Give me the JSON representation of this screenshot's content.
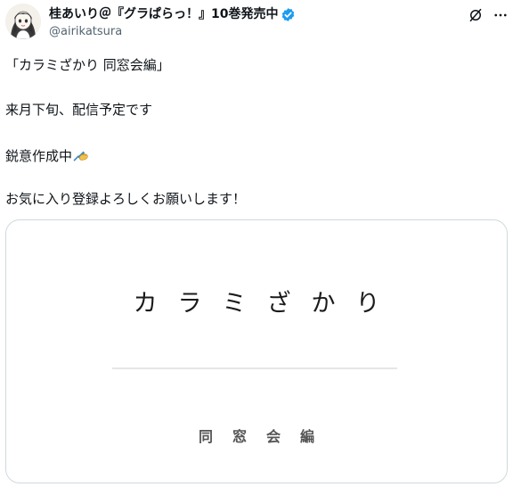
{
  "author": {
    "display_name": "桂あいり＠『グラぱらっ！』10巻発売中",
    "handle": "@airikatsura",
    "verified": true,
    "avatar_icon": "avatar-illustration"
  },
  "actions": {
    "grok_icon": "grok-icon",
    "more_icon": "more-icon"
  },
  "tweet": {
    "line1": "「カラミざかり 同窓会編」",
    "line2": "来月下旬、配信予定です",
    "line3": "鋭意作成中",
    "line3_emoji": "writing-hand-emoji",
    "line4": "お気に入り登録よろしくお願いします！"
  },
  "media": {
    "title": "カラミざかり",
    "subtitle": "同窓会編"
  },
  "colors": {
    "text": "#0f1419",
    "secondary_text": "#536471",
    "verified_blue": "#1d9bf0",
    "card_border": "#cfd9de"
  }
}
